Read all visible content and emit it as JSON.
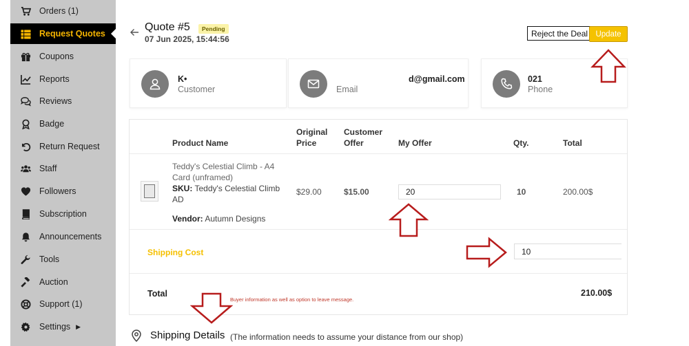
{
  "sidebar": {
    "items": [
      {
        "label": "Orders (1)",
        "icon": "cart-icon"
      },
      {
        "label": "Request Quotes",
        "icon": "list-icon",
        "active": true
      },
      {
        "label": "Coupons",
        "icon": "gift-icon"
      },
      {
        "label": "Reports",
        "icon": "chart-line-icon"
      },
      {
        "label": "Reviews",
        "icon": "comments-icon"
      },
      {
        "label": "Badge",
        "icon": "award-icon"
      },
      {
        "label": "Return Request",
        "icon": "undo-icon"
      },
      {
        "label": "Staff",
        "icon": "users-icon"
      },
      {
        "label": "Followers",
        "icon": "heart-icon"
      },
      {
        "label": "Subscription",
        "icon": "book-icon"
      },
      {
        "label": "Announcements",
        "icon": "bell-icon"
      },
      {
        "label": "Tools",
        "icon": "wrench-icon"
      },
      {
        "label": "Auction",
        "icon": "gavel-icon"
      },
      {
        "label": "Support (1)",
        "icon": "lifebuoy-icon"
      },
      {
        "label": "Settings",
        "icon": "gear-icon",
        "has_submenu": true
      }
    ],
    "active_color": "#f5b400"
  },
  "header": {
    "title": "Quote #5",
    "status": "Pending",
    "date": "07 Jun 2025, 15:44:56",
    "reject_label": "Reject the Deal",
    "update_label": "Update"
  },
  "customer": {
    "name": "K•",
    "name_label": "Customer",
    "email": "d@gmail.com",
    "email_label": "Email",
    "phone": "021",
    "phone_label": "Phone"
  },
  "table": {
    "headers": {
      "product": "Product Name",
      "original_price": "Original Price",
      "customer_offer": "Customer Offer",
      "my_offer": "My Offer",
      "qty": "Qty.",
      "total": "Total"
    },
    "row": {
      "name": "Teddy's Celestial Climb - A4 Card (unframed)",
      "sku_label": "SKU:",
      "sku": "Teddy's Celestial Climb AD",
      "vendor_label": "Vendor:",
      "vendor": "Autumn Designs",
      "original_price": "$29.00",
      "customer_offer": "$15.00",
      "my_offer": "20",
      "qty": "10",
      "total": "200.00$"
    },
    "shipping_label": "Shipping Cost",
    "shipping_value": "10",
    "total_label": "Total",
    "total_value": "210.00$",
    "annotation": "Buyer information as well as option to leave message."
  },
  "shipping_details": {
    "title": "Shipping Details",
    "note": "(The information needs to assume your distance from our shop)"
  },
  "colors": {
    "accent": "#f5c200",
    "annotation_arrow": "#b71c1c"
  }
}
